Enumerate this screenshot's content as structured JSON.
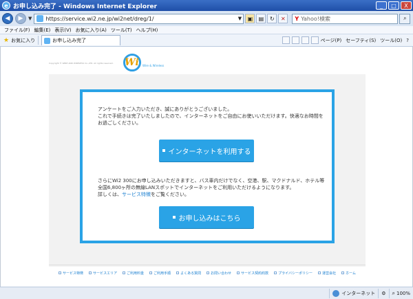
{
  "window": {
    "title": "お申し込み完了 - Windows Internet Explorer",
    "min_glyph": "_",
    "max_glyph": "□",
    "close_glyph": "X"
  },
  "address_bar": {
    "url": "https://service.wi2.ne.jp/wi2net/dreg/1/",
    "search_provider": "Y",
    "search_placeholder": "Yahoo!検索"
  },
  "menu": [
    "ファイル(F)",
    "編集(E)",
    "表示(V)",
    "お気に入り(A)",
    "ツール(T)",
    "ヘルプ(H)"
  ],
  "favorites_bar": {
    "favorites_label": "お気に入り",
    "tab_title": "お申し込み完了",
    "tools": [
      "ページ(P)",
      "セーフティ(S)",
      "ツール(O)"
    ]
  },
  "page": {
    "copyright": "Copyright © WIRE AND WIRELESS Co.,LTD. All rights reserved.",
    "logo_text": "Wi",
    "logo_sub": "Wire & Wireless",
    "message1": "アンケートをご入力いただき、誠にありがとうございました。\nこれで手続きは完了いたしましたので、インターネットをご自由にお使いいただけます。快適なお時間をお過ごしください。",
    "cta1_label": "インターネットを利用する",
    "message2_pre": "さらにWi2 300にお申し込みいただきますと、バス車内だけでなく、空港、駅、マクドナルド、ホテル等全国6,800ヶ所の無線LANスポットでインターネットをご利用いただけるようになります。\n詳しくは、",
    "message2_link": "サービス特徴",
    "message2_post": "をご覧ください。",
    "cta2_label": "お申し込みはこちら"
  },
  "footer_links": [
    "サービス特徴",
    "サービスエリア",
    "ご利用料金",
    "ご利用手順",
    "よくある質問",
    "お問い合わせ",
    "サービス契約約款",
    "プライバシーポリシー",
    "運営会社",
    "ホーム"
  ],
  "status_bar": {
    "zone": "インターネット",
    "zoom": "100%"
  }
}
